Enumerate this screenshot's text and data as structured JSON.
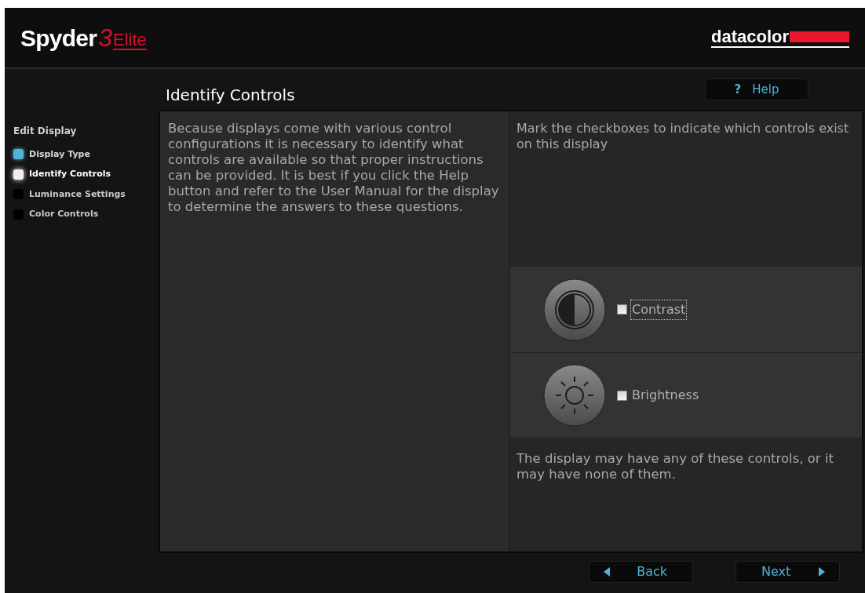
{
  "header": {
    "logo_main": "Spyder",
    "logo_number": "3",
    "logo_edition": "Elite",
    "brand": "datacolor"
  },
  "page_title": "Identify Controls",
  "help_button": {
    "icon": "?",
    "label": "Help"
  },
  "sidebar": {
    "heading": "Edit Display",
    "steps": [
      {
        "label": "Display Type",
        "done": true,
        "selected": false
      },
      {
        "label": "Identify Controls",
        "done": false,
        "selected": true
      },
      {
        "label": "Luminance Settings",
        "done": false,
        "selected": false
      },
      {
        "label": "Color Controls",
        "done": false,
        "selected": false
      }
    ]
  },
  "description": "Because displays come with various control configurations it is necessary to identify what controls are available so that proper instructions can be provided. It is best if you click the Help button and refer to the User Manual for the display to determine the answers to these questions.",
  "instruction": "Mark the checkboxes to indicate which controls exist on this display",
  "controls": [
    {
      "kind": "contrast",
      "label": "Contrast",
      "checked": false,
      "focused": true
    },
    {
      "kind": "brightness",
      "label": "Brightness",
      "checked": false,
      "focused": false
    }
  ],
  "note": "The display may have any of these controls, or it may have none of them.",
  "nav": {
    "back": "Back",
    "next": "Next"
  }
}
